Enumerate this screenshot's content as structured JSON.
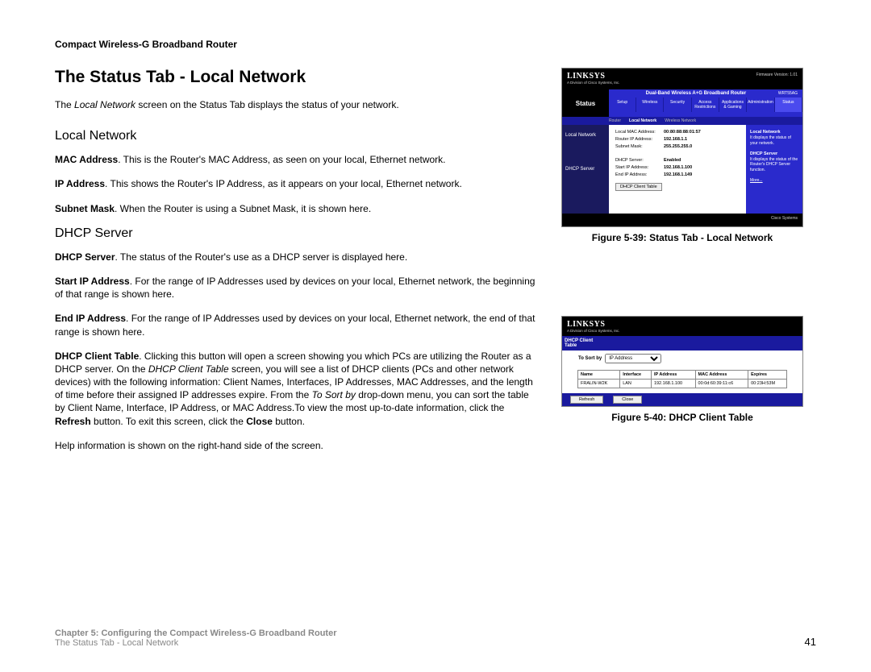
{
  "product_name": "Compact Wireless-G Broadband Router",
  "main_heading": "The Status Tab - Local Network",
  "intro_pre": "The ",
  "intro_em": "Local Network",
  "intro_post": " screen on the Status Tab displays the status of your network.",
  "section1_heading": "Local Network",
  "p_mac_b": "MAC Address",
  "p_mac_t": ". This is the Router's MAC Address, as seen on your local, Ethernet network.",
  "p_ip_b": "IP Address",
  "p_ip_t": ". This shows the Router's IP Address, as it appears on your local, Ethernet network.",
  "p_sm_b": "Subnet Mask",
  "p_sm_t": ". When the Router is using a Subnet Mask, it is shown here.",
  "section2_heading": "DHCP Server",
  "p_ds_b": "DHCP Server",
  "p_ds_t": ". The status of the Router's use as a DHCP server is displayed here.",
  "p_sip_b": "Start IP Address",
  "p_sip_t": ". For the range of IP Addresses used by devices on your local, Ethernet network, the beginning of that range is shown here.",
  "p_eip_b": "End IP Address",
  "p_eip_t": ". For the range of IP Addresses used by devices on your local, Ethernet network, the end of that range is shown here.",
  "big": {
    "p1": "DHCP Client Table",
    "p2": ". Clicking this button will open a screen showing you which PCs are utilizing the Router as a DHCP server. On the ",
    "p3": "DHCP Client Table",
    "p4": " screen, you will see a list of DHCP clients (PCs and other network devices) with the following information: Client Names, Interfaces, IP Addresses, MAC Addresses, and the length of time before their assigned IP addresses expire. From the ",
    "p5": "To Sort by",
    "p6": " drop-down menu, you can sort the table by Client Name, Interface, IP Address, or MAC Address.To view the most up-to-date information, click the ",
    "p7": "Refresh",
    "p8": " button. To exit this screen, click the ",
    "p9": "Close",
    "p10": " button."
  },
  "help_line": "Help information is shown on the right-hand side of the screen.",
  "fig1_caption": "Figure 5-39: Status Tab - Local Network",
  "fig2_caption": "Figure 5-40: DHCP Client Table",
  "fig1": {
    "brand": "LINKSYS",
    "brand_sub": "A Division of Cisco Systems, Inc.",
    "fw": "Firmware Version: 1.01",
    "model_title": "Dual-Band Wireless A+G Broadband Router",
    "model": "WRT55AG",
    "status_label": "Status",
    "tabs": [
      "Setup",
      "Wireless",
      "Security",
      "Access Restrictions",
      "Applications & Gaming",
      "Administration",
      "Status"
    ],
    "subtabs": [
      "Router",
      "Local Network",
      "Wireless Network"
    ],
    "left1": "Local Network",
    "left2": "DHCP Server",
    "kv": [
      {
        "k": "Local MAC Address:",
        "v": "00:80:88:88:01:57"
      },
      {
        "k": "Router IP Address:",
        "v": "192.168.1.1"
      },
      {
        "k": "Subnet Mask:",
        "v": "255.255.255.0"
      },
      {
        "k": "DHCP Server:",
        "v": "Enabled"
      },
      {
        "k": "Start IP Address:",
        "v": "192.168.1.100"
      },
      {
        "k": "End IP Address:",
        "v": "192.168.1.149"
      }
    ],
    "btn": "DHCP Client Table",
    "help_h1": "Local Network",
    "help_t1": "It displays the status of your network.",
    "help_h2": "DHCP Server",
    "help_t2": "It displays the status of the Router's DHCP Server function.",
    "more": "More...",
    "cisco": "Cisco Systems"
  },
  "fig2": {
    "brand": "LINKSYS",
    "brand_sub": "A Division of Cisco Systems, Inc.",
    "label": "DHCP Client Table",
    "sort": "To Sort by",
    "sort_val": "IP Address",
    "headers": [
      "Name",
      "Interface",
      "IP Address",
      "MAC Address",
      "Expires"
    ],
    "row": [
      "FRALIN-W2K",
      "LAN",
      "192.168.1.100",
      "00:0d:60:39:11:c6",
      "00:23H:53M"
    ],
    "refresh": "Refresh",
    "close": "Close"
  },
  "footer": {
    "chapter": "Chapter 5: Configuring the Compact Wireless-G Broadband Router",
    "section": "The Status Tab - Local Network",
    "page": "41"
  }
}
